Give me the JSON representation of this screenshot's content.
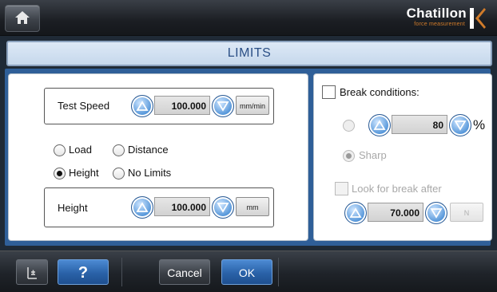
{
  "header": {
    "home_icon": "home-icon",
    "logo_name": "Chatillon",
    "logo_tagline": "force measurement",
    "accent_color": "#d07b2a"
  },
  "title": "LIMITS",
  "left": {
    "test_speed": {
      "label": "Test Speed",
      "value": "100.000",
      "unit": "mm/min"
    },
    "limit_type": {
      "options": [
        "Load",
        "Distance",
        "Height",
        "No Limits"
      ],
      "selected": "Height"
    },
    "height": {
      "label": "Height",
      "value": "100.000",
      "unit": "mm"
    }
  },
  "right": {
    "break_conditions_label": "Break conditions:",
    "break_conditions_checked": false,
    "percent_value": "80",
    "percent_unit": "%",
    "sharp_label": "Sharp",
    "look_for_break_label": "Look for break after",
    "look_for_break_checked": false,
    "break_after_value": "70.000",
    "break_after_unit": "N"
  },
  "footer": {
    "help_label": "?",
    "cancel_label": "Cancel",
    "ok_label": "OK"
  }
}
